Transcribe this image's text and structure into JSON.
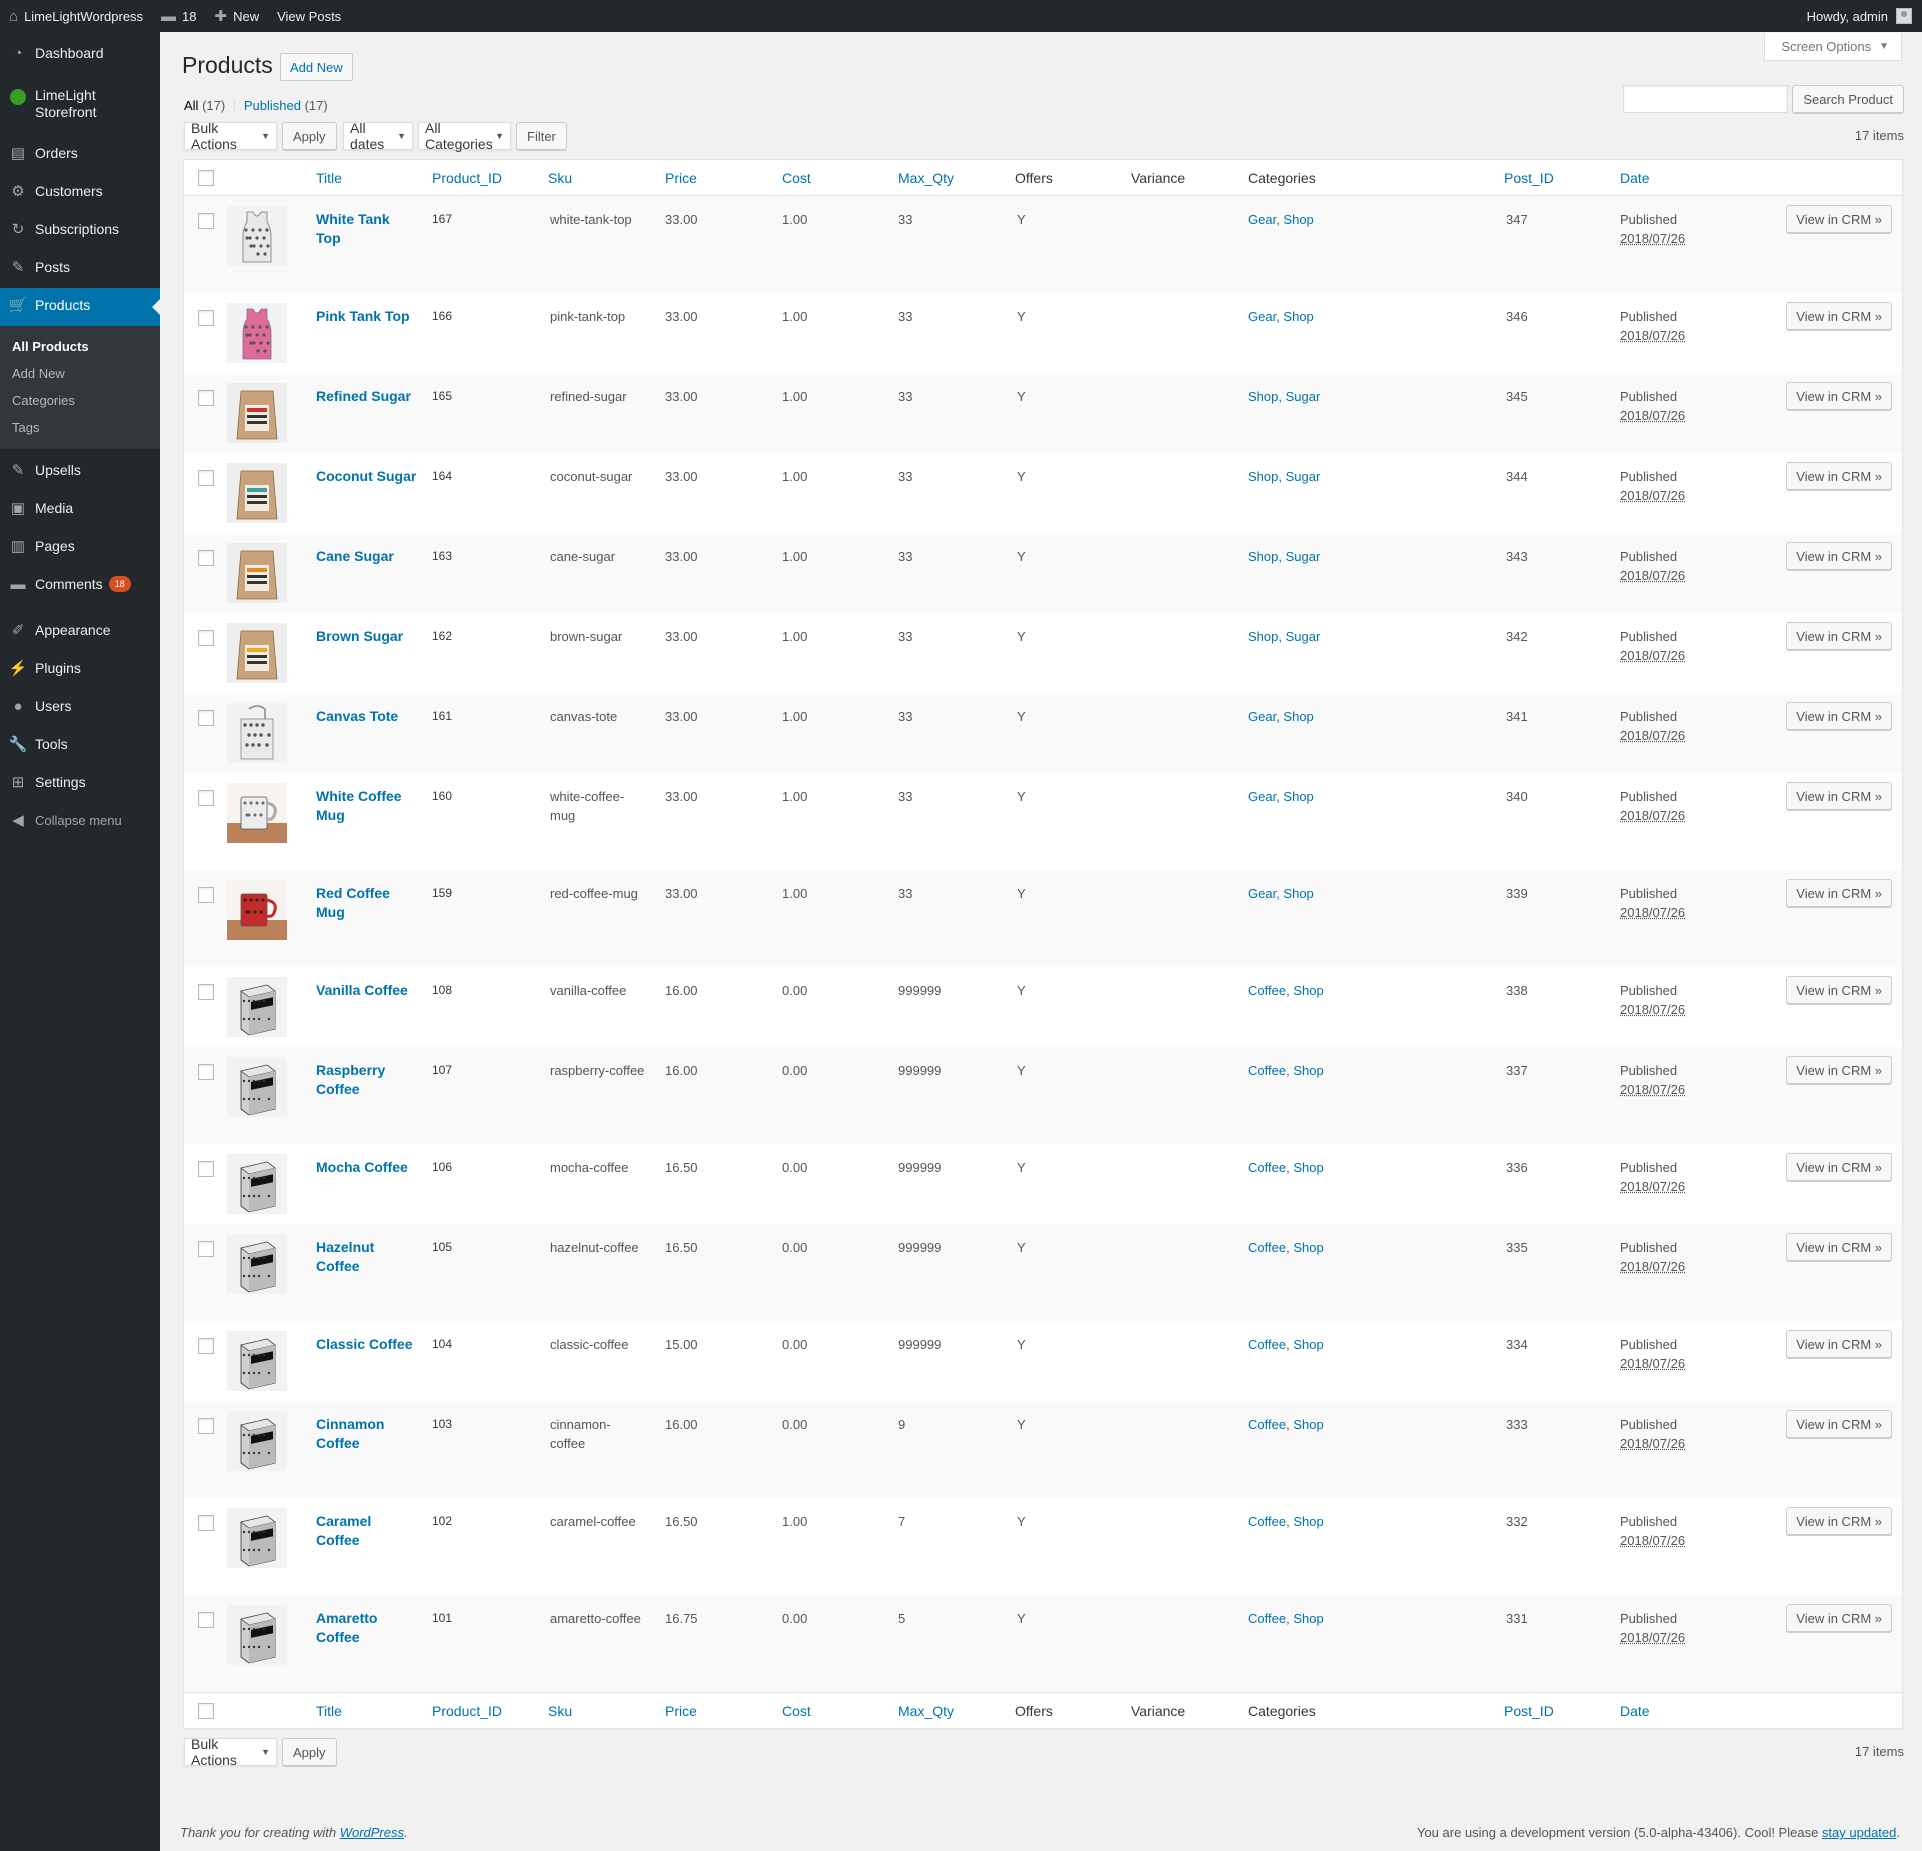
{
  "adminbar": {
    "site_name": "LimeLightWordpress",
    "comments_count": "18",
    "new_label": "New",
    "view_posts": "View Posts",
    "howdy": "Howdy, admin"
  },
  "sidebar": {
    "items": [
      {
        "label": "Dashboard",
        "icon": "dashboard-icon",
        "glyph": "◔"
      },
      {
        "label": "LimeLight\nStorefront",
        "icon": "limelight-icon",
        "glyph": ""
      },
      {
        "label": "Orders",
        "icon": "orders-icon",
        "glyph": "▤"
      },
      {
        "label": "Customers",
        "icon": "customers-icon",
        "glyph": "⚙"
      },
      {
        "label": "Subscriptions",
        "icon": "subscriptions-icon",
        "glyph": "↻"
      },
      {
        "label": "Posts",
        "icon": "posts-icon",
        "glyph": "✎"
      },
      {
        "label": "Products",
        "icon": "cart-icon",
        "glyph": "🛒"
      }
    ],
    "submenu": [
      "All Products",
      "Add New",
      "Categories",
      "Tags"
    ],
    "items2": [
      {
        "label": "Upsells",
        "icon": "upsells-icon",
        "glyph": "✎"
      },
      {
        "label": "Media",
        "icon": "media-icon",
        "glyph": "▣"
      },
      {
        "label": "Pages",
        "icon": "pages-icon",
        "glyph": "▥"
      },
      {
        "label": "Comments",
        "icon": "comments-icon",
        "glyph": "▬"
      }
    ],
    "comments_bubble": "18",
    "items3": [
      {
        "label": "Appearance",
        "icon": "appearance-icon",
        "glyph": "✐"
      },
      {
        "label": "Plugins",
        "icon": "plugins-icon",
        "glyph": "⚡"
      },
      {
        "label": "Users",
        "icon": "users-icon",
        "glyph": "●"
      },
      {
        "label": "Tools",
        "icon": "tools-icon",
        "glyph": "🔧"
      },
      {
        "label": "Settings",
        "icon": "settings-icon",
        "glyph": "⊞"
      }
    ],
    "collapse": "Collapse menu"
  },
  "page": {
    "title": "Products",
    "add_new": "Add New",
    "screen_options": "Screen Options",
    "filters": {
      "all": "All",
      "all_count": "(17)",
      "published": "Published",
      "published_count": "(17)"
    },
    "search_button": "Search Product",
    "search_value": "",
    "bulk_actions": "Bulk Actions",
    "apply": "Apply",
    "all_dates": "All dates",
    "all_categories": "All Categories",
    "filter": "Filter",
    "items_count": "17 items"
  },
  "table": {
    "columns": [
      "Title",
      "Product_ID",
      "Sku",
      "Price",
      "Cost",
      "Max_Qty",
      "Offers",
      "Variance",
      "Categories",
      "Post_ID",
      "Date"
    ],
    "view_in_crm": "View in CRM »",
    "rows": [
      {
        "title": "White Tank\nTop",
        "pid": "167",
        "sku": "white-tank-top",
        "price": "33.00",
        "cost": "1.00",
        "maxqty": "33",
        "offers": "Y",
        "cat1": "Gear",
        "cat2": "Shop",
        "post_id": "347",
        "status": "Published",
        "date": "2018/07/26",
        "thumb": "tank-white"
      },
      {
        "title": "Pink Tank Top",
        "pid": "166",
        "sku": "pink-tank-top",
        "price": "33.00",
        "cost": "1.00",
        "maxqty": "33",
        "offers": "Y",
        "cat1": "Gear",
        "cat2": "Shop",
        "post_id": "346",
        "status": "Published",
        "date": "2018/07/26",
        "thumb": "tank-pink"
      },
      {
        "title": "Refined Sugar",
        "pid": "165",
        "sku": "refined-sugar",
        "price": "33.00",
        "cost": "1.00",
        "maxqty": "33",
        "offers": "Y",
        "cat1": "Shop",
        "cat2": "Sugar",
        "post_id": "345",
        "status": "Published",
        "date": "2018/07/26",
        "thumb": "bag-red"
      },
      {
        "title": "Coconut Sugar",
        "pid": "164",
        "sku": "coconut-sugar",
        "price": "33.00",
        "cost": "1.00",
        "maxqty": "33",
        "offers": "Y",
        "cat1": "Shop",
        "cat2": "Sugar",
        "post_id": "344",
        "status": "Published",
        "date": "2018/07/26",
        "thumb": "bag-teal"
      },
      {
        "title": "Cane Sugar",
        "pid": "163",
        "sku": "cane-sugar",
        "price": "33.00",
        "cost": "1.00",
        "maxqty": "33",
        "offers": "Y",
        "cat1": "Shop",
        "cat2": "Sugar",
        "post_id": "343",
        "status": "Published",
        "date": "2018/07/26",
        "thumb": "bag-orange"
      },
      {
        "title": "Brown Sugar",
        "pid": "162",
        "sku": "brown-sugar",
        "price": "33.00",
        "cost": "1.00",
        "maxqty": "33",
        "offers": "Y",
        "cat1": "Shop",
        "cat2": "Sugar",
        "post_id": "342",
        "status": "Published",
        "date": "2018/07/26",
        "thumb": "bag-yellow"
      },
      {
        "title": "Canvas Tote",
        "pid": "161",
        "sku": "canvas-tote",
        "price": "33.00",
        "cost": "1.00",
        "maxqty": "33",
        "offers": "Y",
        "cat1": "Gear",
        "cat2": "Shop",
        "post_id": "341",
        "status": "Published",
        "date": "2018/07/26",
        "thumb": "tote"
      },
      {
        "title": "White Coffee\nMug",
        "pid": "160",
        "sku": "white-coffee-\nmug",
        "price": "33.00",
        "cost": "1.00",
        "maxqty": "33",
        "offers": "Y",
        "cat1": "Gear",
        "cat2": "Shop",
        "post_id": "340",
        "status": "Published",
        "date": "2018/07/26",
        "thumb": "mug-white"
      },
      {
        "title": "Red Coffee\nMug",
        "pid": "159",
        "sku": "red-coffee-mug",
        "price": "33.00",
        "cost": "1.00",
        "maxqty": "33",
        "offers": "Y",
        "cat1": "Gear",
        "cat2": "Shop",
        "post_id": "339",
        "status": "Published",
        "date": "2018/07/26",
        "thumb": "mug-red"
      },
      {
        "title": "Vanilla Coffee",
        "pid": "108",
        "sku": "vanilla-coffee",
        "price": "16.00",
        "cost": "0.00",
        "maxqty": "999999",
        "offers": "Y",
        "cat1": "Coffee",
        "cat2": "Shop",
        "post_id": "338",
        "status": "Published",
        "date": "2018/07/26",
        "thumb": "coffee"
      },
      {
        "title": "Raspberry\nCoffee",
        "pid": "107",
        "sku": "raspberry-coffee",
        "price": "16.00",
        "cost": "0.00",
        "maxqty": "999999",
        "offers": "Y",
        "cat1": "Coffee",
        "cat2": "Shop",
        "post_id": "337",
        "status": "Published",
        "date": "2018/07/26",
        "thumb": "coffee"
      },
      {
        "title": "Mocha Coffee",
        "pid": "106",
        "sku": "mocha-coffee",
        "price": "16.50",
        "cost": "0.00",
        "maxqty": "999999",
        "offers": "Y",
        "cat1": "Coffee",
        "cat2": "Shop",
        "post_id": "336",
        "status": "Published",
        "date": "2018/07/26",
        "thumb": "coffee"
      },
      {
        "title": "Hazelnut\nCoffee",
        "pid": "105",
        "sku": "hazelnut-coffee",
        "price": "16.50",
        "cost": "0.00",
        "maxqty": "999999",
        "offers": "Y",
        "cat1": "Coffee",
        "cat2": "Shop",
        "post_id": "335",
        "status": "Published",
        "date": "2018/07/26",
        "thumb": "coffee"
      },
      {
        "title": "Classic Coffee",
        "pid": "104",
        "sku": "classic-coffee",
        "price": "15.00",
        "cost": "0.00",
        "maxqty": "999999",
        "offers": "Y",
        "cat1": "Coffee",
        "cat2": "Shop",
        "post_id": "334",
        "status": "Published",
        "date": "2018/07/26",
        "thumb": "coffee"
      },
      {
        "title": "Cinnamon\nCoffee",
        "pid": "103",
        "sku": "cinnamon-\ncoffee",
        "price": "16.00",
        "cost": "0.00",
        "maxqty": "9",
        "offers": "Y",
        "cat1": "Coffee",
        "cat2": "Shop",
        "post_id": "333",
        "status": "Published",
        "date": "2018/07/26",
        "thumb": "coffee"
      },
      {
        "title": "Caramel\nCoffee",
        "pid": "102",
        "sku": "caramel-coffee",
        "price": "16.50",
        "cost": "1.00",
        "maxqty": "7",
        "offers": "Y",
        "cat1": "Coffee",
        "cat2": "Shop",
        "post_id": "332",
        "status": "Published",
        "date": "2018/07/26",
        "thumb": "coffee"
      },
      {
        "title": "Amaretto\nCoffee",
        "pid": "101",
        "sku": "amaretto-coffee",
        "price": "16.75",
        "cost": "0.00",
        "maxqty": "5",
        "offers": "Y",
        "cat1": "Coffee",
        "cat2": "Shop",
        "post_id": "331",
        "status": "Published",
        "date": "2018/07/26",
        "thumb": "coffee"
      }
    ]
  },
  "footer": {
    "left_text": "Thank you for creating with ",
    "left_link": "WordPress",
    "left_end": ".",
    "right_text": "You are using a development version (5.0-alpha-43406). Cool! Please ",
    "right_link": "stay updated",
    "right_end": "."
  },
  "colors": {
    "admin_bg": "#23282d",
    "accent": "#0073aa",
    "bubble": "#d54e21"
  }
}
